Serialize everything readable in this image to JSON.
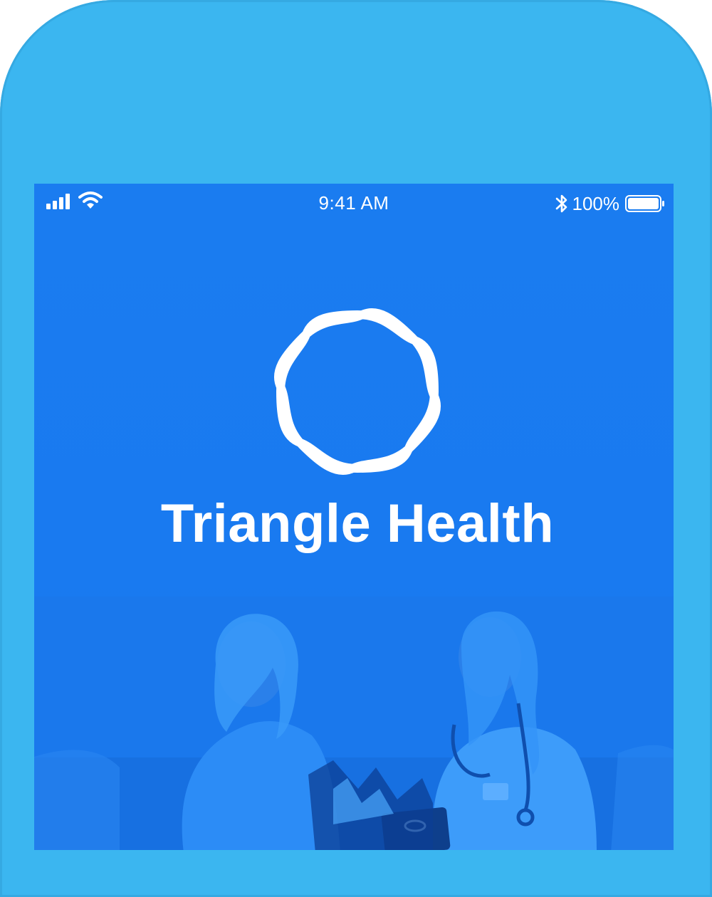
{
  "status_bar": {
    "time": "9:41 AM",
    "battery_percent": "100%",
    "battery_level": 1.0,
    "icons": [
      "signal-icon",
      "wifi-icon",
      "bluetooth-icon",
      "battery-icon"
    ]
  },
  "splash": {
    "app_name": "Triangle Health",
    "logo_icon": "triangle-health-logo",
    "hero_image": "patient-and-doctor-photo"
  },
  "colors": {
    "device_frame": "#3bb6f0",
    "screen_background": "#1a7cf0",
    "foreground": "#ffffff"
  }
}
